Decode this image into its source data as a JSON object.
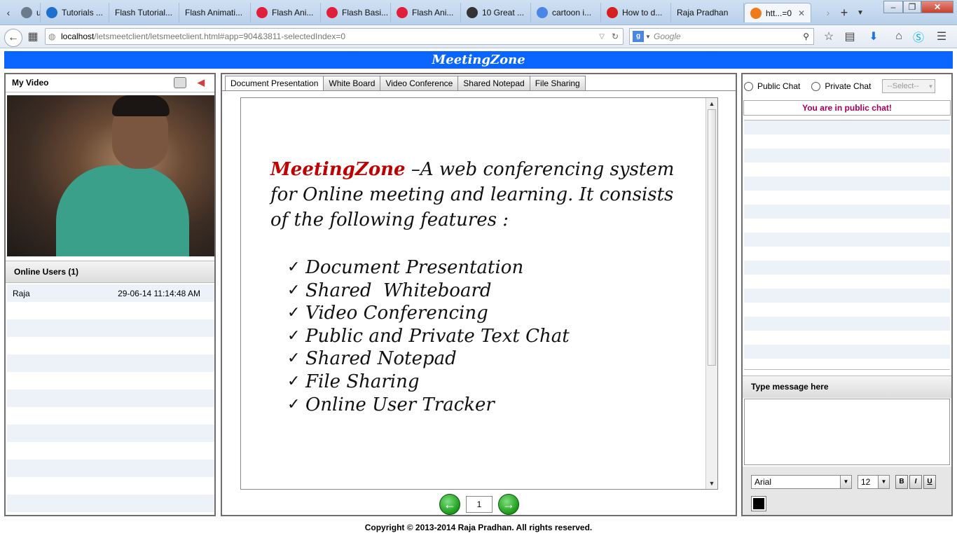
{
  "browser": {
    "tabs": [
      {
        "label": "ut...",
        "favicon": "generic-icon",
        "color": "#6b7b8c"
      },
      {
        "label": "Tutorials ...",
        "favicon": "f-logo-icon",
        "color": "#1e6fd0"
      },
      {
        "label": "Flash Tutorial...",
        "favicon": "none",
        "color": ""
      },
      {
        "label": "Flash Animati...",
        "favicon": "none",
        "color": ""
      },
      {
        "label": "Flash Ani...",
        "favicon": "red-circle-icon",
        "color": "#e0203a"
      },
      {
        "label": "Flash Basi...",
        "favicon": "red-circle-icon",
        "color": "#e0203a"
      },
      {
        "label": "Flash Ani...",
        "favicon": "red-circle-icon",
        "color": "#e0203a"
      },
      {
        "label": "10 Great ...",
        "favicon": "fx-icon",
        "color": "#333333"
      },
      {
        "label": "cartoon i...",
        "favicon": "google-icon",
        "color": "#4a86e8"
      },
      {
        "label": "How to d...",
        "favicon": "youtube-icon",
        "color": "#d61f1f"
      },
      {
        "label": "Raja Pradhan",
        "favicon": "none",
        "color": ""
      },
      {
        "label": "htt...=0",
        "favicon": "app-icon",
        "color": "#f07a1a"
      }
    ],
    "url_host": "localhost",
    "url_rest": "/letsmeetclient/letsmeetclient.html#app=904&3811-selectedIndex=0",
    "search_placeholder": "Google"
  },
  "app": {
    "title": "MeetingZone",
    "left": {
      "video_label": "My Video",
      "users_heading": "Online Users (1)",
      "users": [
        {
          "name": "Raja",
          "time": "29-06-14 11:14:48 AM"
        }
      ]
    },
    "center": {
      "tabs": [
        "Document Presentation",
        "White Board",
        "Video Conference",
        "Shared Notepad",
        "File Sharing"
      ],
      "intro_brand": "MeetingZone",
      "intro_text": " –A web conferencing system for Online meeting and learning. It consists of the following features :",
      "features": [
        "Document Presentation",
        "Shared  Whiteboard",
        "Video Conferencing",
        "Public and Private Text Chat",
        "Shared Notepad",
        "File Sharing",
        "Online User Tracker"
      ],
      "page_number": "1"
    },
    "right": {
      "public_chat": "Public Chat",
      "private_chat": "Private Chat",
      "select_placeholder": "--Select--",
      "status": "You are in public chat!",
      "type_heading": "Type message here",
      "font_name": "Arial",
      "font_size": "12",
      "bold": "B",
      "italic": "I",
      "underline": "U",
      "text_color": "#000000"
    },
    "footer": "Copyright © 2013-2014  Raja Pradhan. All rights reserved."
  },
  "colors": {
    "header_blue": "#0a66ff",
    "brand_red": "#c00000",
    "status_magenta": "#a0005a"
  }
}
